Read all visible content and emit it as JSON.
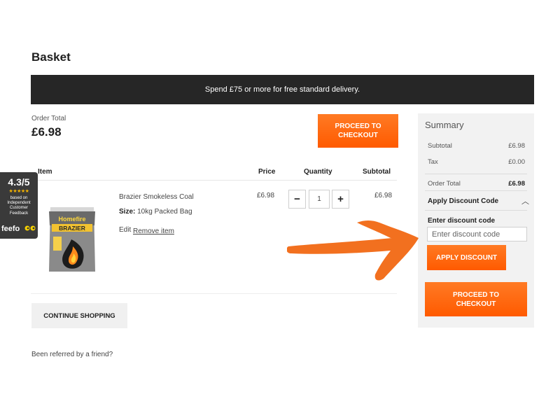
{
  "page": {
    "title": "Basket"
  },
  "promo": {
    "text": "Spend £75 or more for free standard delivery."
  },
  "order_total": {
    "label": "Order Total",
    "value": "£6.98"
  },
  "buttons": {
    "proceed_checkout": "PROCEED TO CHECKOUT",
    "continue_shopping": "CONTINUE SHOPPING",
    "apply_discount": "APPLY DISCOUNT"
  },
  "table": {
    "headers": {
      "item": "Item",
      "price": "Price",
      "quantity": "Quantity",
      "subtotal": "Subtotal"
    },
    "rows": [
      {
        "name": "Brazier Smokeless Coal",
        "size_label": "Size:",
        "size_value": "10kg Packed Bag",
        "price": "£6.98",
        "quantity": "1",
        "subtotal": "£6.98",
        "edit": "Edit",
        "remove": "Remove item",
        "image_brand": "Homefire",
        "image_product": "BRAZIER"
      }
    ]
  },
  "referral": {
    "text": "Been referred by a friend?"
  },
  "summary": {
    "title": "Summary",
    "subtotal_label": "Subtotal",
    "subtotal_value": "£6.98",
    "tax_label": "Tax",
    "tax_value": "£0.00",
    "order_total_label": "Order Total",
    "order_total_value": "£6.98",
    "discount_heading": "Apply Discount Code",
    "discount_label": "Enter discount code",
    "discount_placeholder": "Enter discount code",
    "discount_value": ""
  },
  "feefo": {
    "score": "4.3/5",
    "stars": "★★★★★",
    "text": "based on Independent Customer Feedback",
    "logo": "feefo"
  },
  "colors": {
    "accent": "#ff6a10",
    "promo_bar": "#262626",
    "summary_bg": "#f2f2f2",
    "arrow": "#f2701f"
  },
  "icons": {
    "caret": "chevron-up-icon",
    "minus": "minus-icon",
    "plus": "plus-icon",
    "arrow": "arrow-right-icon"
  }
}
